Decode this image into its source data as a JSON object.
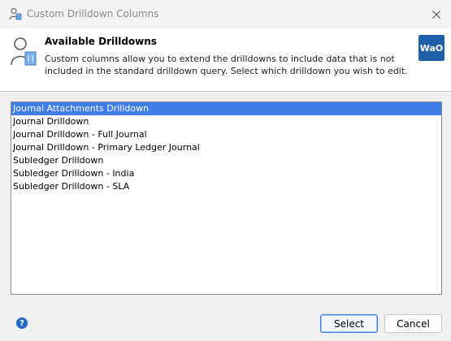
{
  "window": {
    "title": "Custom Drilldown Columns"
  },
  "header": {
    "title": "Available Drilldowns",
    "description": "Custom columns allow you to extend the drilldowns to include data that is not included in the standard drilldown query. Select which drilldown you wish to edit.",
    "logo_text": "WaO"
  },
  "drilldowns": {
    "items": [
      "Journal Attachments Drilldown",
      "Journal Drilldown",
      "Journal Drilldown - Full Journal",
      "Journal Drilldown - Primary Ledger Journal",
      "Subledger Drilldown",
      "Subledger Drilldown - India",
      "Subledger Drilldown - SLA"
    ],
    "selected_index": 0
  },
  "footer": {
    "help_label": "?",
    "select_label": "Select",
    "cancel_label": "Cancel"
  },
  "colors": {
    "accent": "#3f7ee8",
    "logo_bg": "#1f5fa8"
  }
}
